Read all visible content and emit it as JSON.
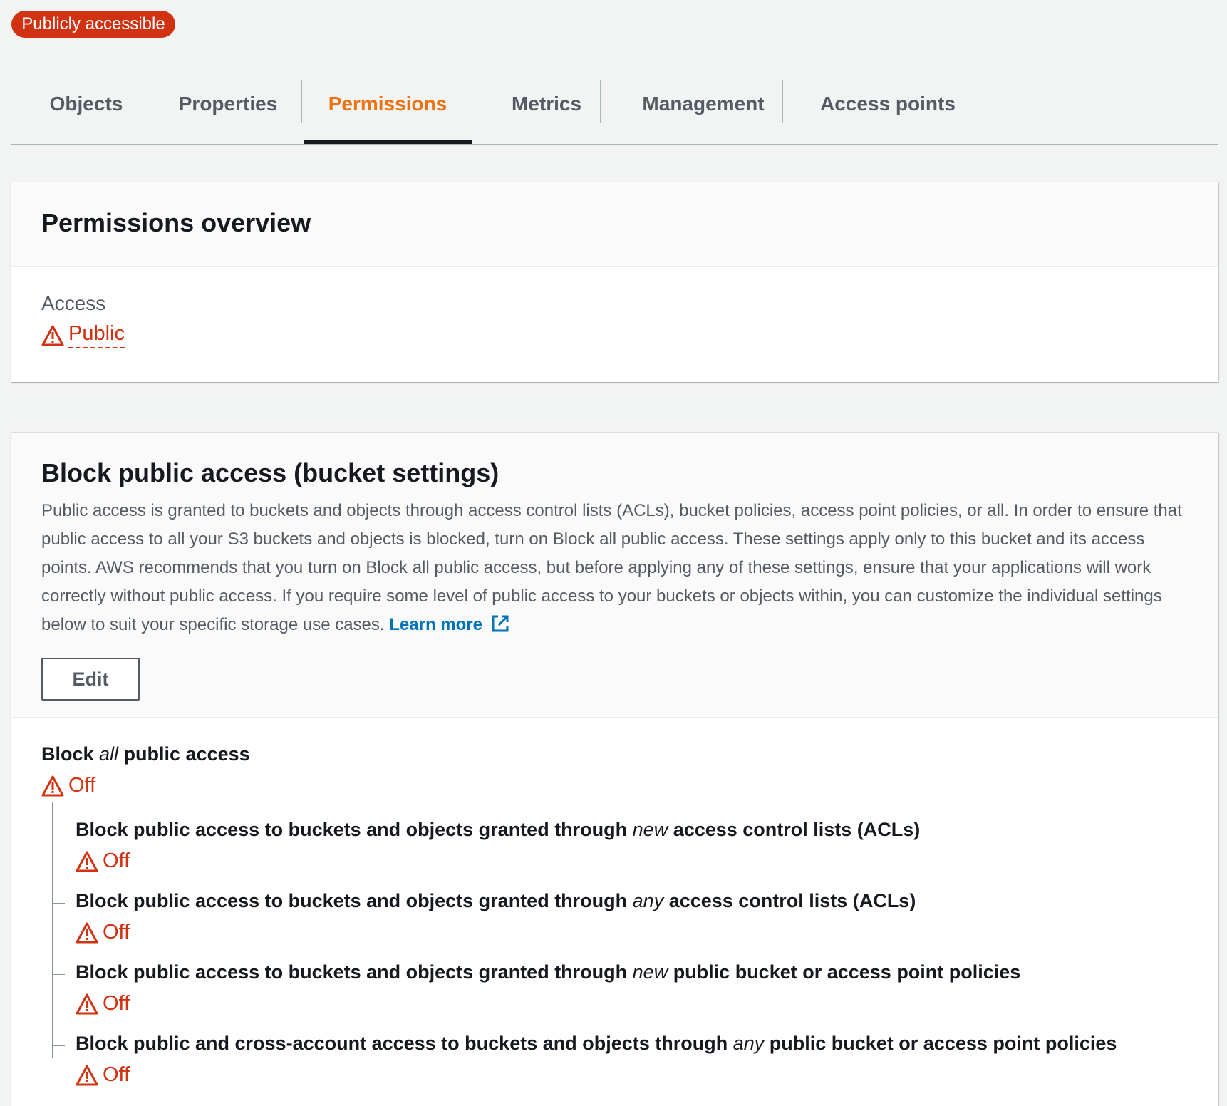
{
  "badge": {
    "label": "Publicly accessible"
  },
  "tabs": [
    {
      "label": "Objects"
    },
    {
      "label": "Properties"
    },
    {
      "label": "Permissions"
    },
    {
      "label": "Metrics"
    },
    {
      "label": "Management"
    },
    {
      "label": "Access points"
    }
  ],
  "active_tab": "Permissions",
  "overview": {
    "title": "Permissions overview",
    "access_label": "Access",
    "access_value": "Public",
    "access_icon": "warning-icon"
  },
  "block_public_access": {
    "title": "Block public access (bucket settings)",
    "description": "Public access is granted to buckets and objects through access control lists (ACLs), bucket policies, access point policies, or all. In order to ensure that public access to all your S3 buckets and objects is blocked, turn on Block all public access. These settings apply only to this bucket and its access points. AWS recommends that you turn on Block all public access, but before applying any of these settings, ensure that your applications will work correctly without public access. If you require some level of public access to your buckets or objects within, you can customize the individual settings below to suit your specific storage use cases.",
    "learn_more": "Learn more",
    "learn_more_icon": "external-link-icon",
    "edit_label": "Edit",
    "main_setting": {
      "title_before": "Block ",
      "title_em": "all",
      "title_after": " public access",
      "status": "Off"
    },
    "sub_settings": [
      {
        "title_before": "Block public access to buckets and objects granted through ",
        "title_em": "new",
        "title_after": " access control lists (ACLs)",
        "status": "Off"
      },
      {
        "title_before": "Block public access to buckets and objects granted through ",
        "title_em": "any",
        "title_after": " access control lists (ACLs)",
        "status": "Off"
      },
      {
        "title_before": "Block public access to buckets and objects granted through ",
        "title_em": "new",
        "title_after": " public bucket or access point policies",
        "status": "Off"
      },
      {
        "title_before": "Block public and cross-account access to buckets and objects through ",
        "title_em": "any",
        "title_after": " public bucket or access point policies",
        "status": "Off"
      }
    ]
  },
  "colors": {
    "danger": "#d13212",
    "active_tab": "#ec7211",
    "link": "#0073bb",
    "background": "#f2f3f3"
  }
}
